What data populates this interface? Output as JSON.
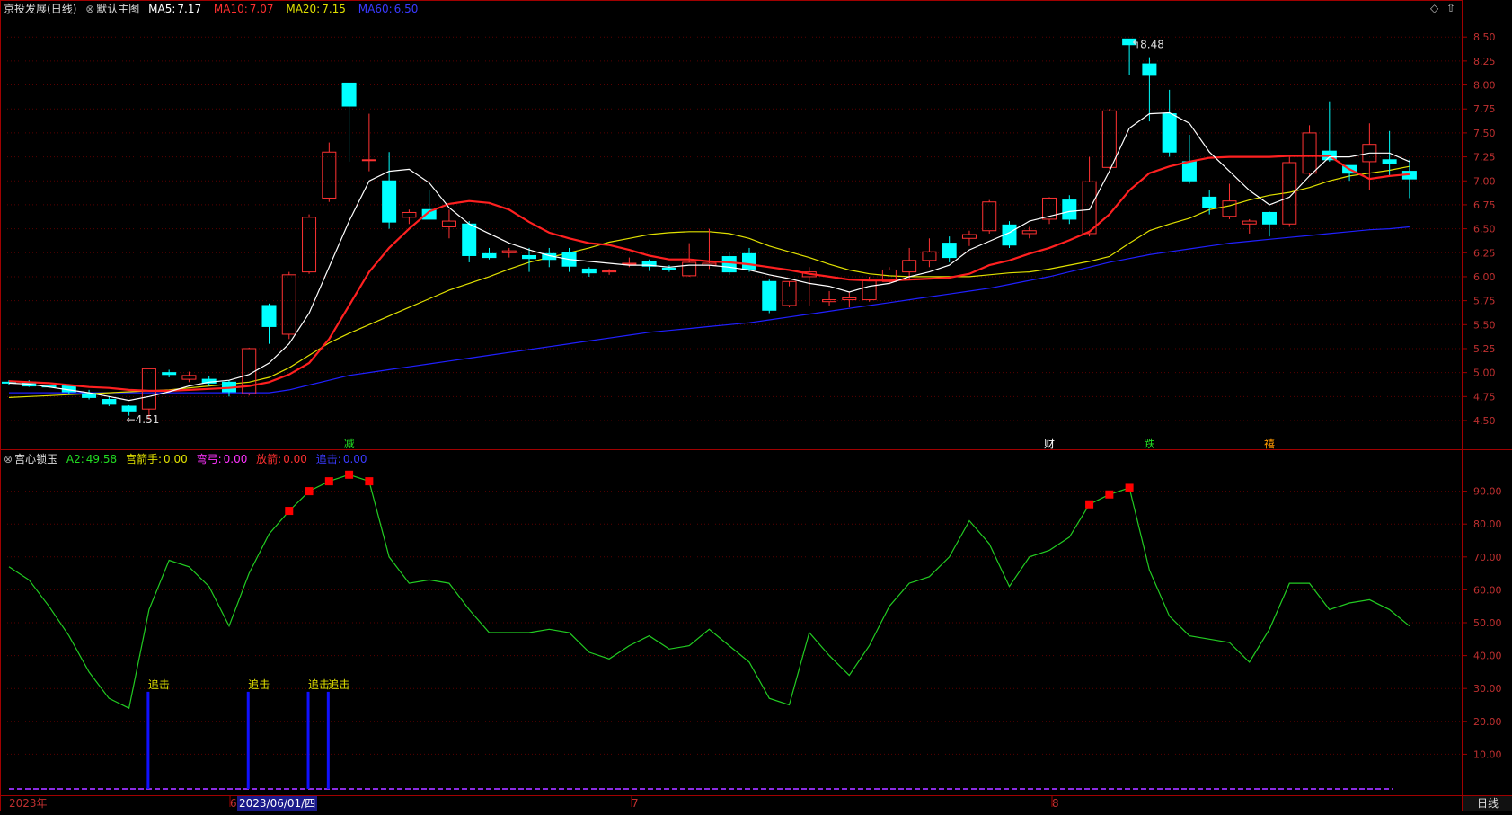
{
  "colors": {
    "bg": "#000000",
    "grid": "#5a0000",
    "axis": "#a00000",
    "up": "#ff3232",
    "down": "#00ffff",
    "ma5": "#ffffff",
    "ma10": "#ff2020",
    "ma20": "#e0e000",
    "ma60": "#2020ff",
    "osc": "#22cc22",
    "marker": "#ff0000",
    "pursuit": "#1010ff",
    "pursuit_label": "#e0e000"
  },
  "header": {
    "stock_name": "京投发展",
    "period_tag": "(日线)",
    "template_name": "默认主图",
    "ma5_label": "MA5:",
    "ma5_value": "7.17",
    "ma10_label": "MA10:",
    "ma10_value": "7.07",
    "ma20_label": "MA20:",
    "ma20_value": "7.15",
    "ma60_label": "MA60:",
    "ma60_value": "6.50",
    "diamond_icon": "◇",
    "up_arrow_icon": "⇧"
  },
  "indicator_header": {
    "name": "宫心锁玉",
    "a2_label": "A2:",
    "a2_value": "49.58",
    "gongjian_label": "宫箭手:",
    "gongjian_value": "0.00",
    "wangong_label": "弯弓:",
    "wangong_value": "0.00",
    "fangjian_label": "放箭:",
    "fangjian_value": "0.00",
    "zhuiji_label": "追击:",
    "zhuiji_value": "0.00"
  },
  "price_axis": [
    "8.50",
    "8.25",
    "8.00",
    "7.75",
    "7.50",
    "7.25",
    "7.00",
    "6.75",
    "6.50",
    "6.25",
    "6.00",
    "5.75",
    "5.50",
    "5.25",
    "5.00",
    "4.75",
    "4.50"
  ],
  "osc_axis": [
    "90.00",
    "80.00",
    "70.00",
    "60.00",
    "50.00",
    "40.00",
    "30.00",
    "20.00",
    "10.00"
  ],
  "annotations": {
    "high": "8.48",
    "low": "4.51"
  },
  "event_labels": [
    {
      "text": "减",
      "index": 17,
      "color": "#22dd22"
    },
    {
      "text": "财",
      "index": 52,
      "color": "#ffffff"
    },
    {
      "text": "跌",
      "index": 57,
      "color": "#22dd22"
    },
    {
      "text": "禧",
      "index": 63,
      "color": "#ff9900"
    }
  ],
  "pursuit_label": "追击",
  "time_axis": {
    "year": "2023年",
    "m6": "6",
    "cursor_date": "2023/06/01/四",
    "m7": "7",
    "m8": "8"
  },
  "period_button": "日线",
  "chart_data": {
    "type": "candlestick",
    "ylim": [
      4.35,
      8.68
    ],
    "osc_ylim": [
      0,
      100
    ],
    "candles": [
      [
        4.9,
        4.92,
        4.87,
        4.89
      ],
      [
        4.9,
        4.92,
        4.85,
        4.86
      ],
      [
        4.86,
        4.9,
        4.83,
        4.85
      ],
      [
        4.86,
        4.88,
        4.77,
        4.8
      ],
      [
        4.78,
        4.82,
        4.72,
        4.74
      ],
      [
        4.72,
        4.75,
        4.65,
        4.67
      ],
      [
        4.65,
        4.66,
        4.55,
        4.6
      ],
      [
        4.62,
        5.05,
        4.51,
        5.04
      ],
      [
        5.0,
        5.03,
        4.95,
        4.98
      ],
      [
        4.93,
        5.01,
        4.9,
        4.97
      ],
      [
        4.93,
        4.96,
        4.86,
        4.89
      ],
      [
        4.9,
        4.92,
        4.75,
        4.8
      ],
      [
        4.78,
        5.26,
        4.76,
        5.25
      ],
      [
        5.7,
        5.72,
        5.3,
        5.48
      ],
      [
        5.4,
        6.05,
        5.35,
        6.02
      ],
      [
        6.05,
        6.65,
        6.03,
        6.62
      ],
      [
        6.82,
        7.4,
        6.78,
        7.3
      ],
      [
        8.02,
        8.02,
        7.2,
        7.78
      ],
      [
        7.22,
        7.7,
        7.1,
        7.22
      ],
      [
        7.0,
        7.3,
        6.5,
        6.57
      ],
      [
        6.62,
        6.7,
        6.55,
        6.67
      ],
      [
        6.7,
        6.9,
        6.6,
        6.6
      ],
      [
        6.52,
        6.7,
        6.4,
        6.58
      ],
      [
        6.55,
        6.58,
        6.15,
        6.22
      ],
      [
        6.24,
        6.3,
        6.18,
        6.2
      ],
      [
        6.25,
        6.3,
        6.2,
        6.27
      ],
      [
        6.22,
        6.3,
        6.05,
        6.19
      ],
      [
        6.24,
        6.3,
        6.1,
        6.18
      ],
      [
        6.25,
        6.3,
        6.05,
        6.11
      ],
      [
        6.08,
        6.1,
        6.0,
        6.04
      ],
      [
        6.05,
        6.08,
        6.02,
        6.06
      ],
      [
        6.13,
        6.2,
        6.1,
        6.14
      ],
      [
        6.16,
        6.18,
        6.06,
        6.11
      ],
      [
        6.09,
        6.12,
        6.05,
        6.07
      ],
      [
        6.01,
        6.35,
        6.0,
        6.15
      ],
      [
        6.12,
        6.5,
        6.08,
        6.14
      ],
      [
        6.21,
        6.25,
        6.02,
        6.05
      ],
      [
        6.24,
        6.3,
        6.05,
        6.08
      ],
      [
        5.95,
        5.97,
        5.62,
        5.65
      ],
      [
        5.7,
        5.9,
        5.68,
        5.95
      ],
      [
        6.0,
        6.1,
        5.7,
        6.05
      ],
      [
        5.74,
        5.85,
        5.7,
        5.76
      ],
      [
        5.76,
        5.84,
        5.68,
        5.78
      ],
      [
        5.76,
        6.0,
        5.74,
        5.96
      ],
      [
        5.95,
        6.1,
        5.92,
        6.07
      ],
      [
        6.05,
        6.3,
        5.98,
        6.17
      ],
      [
        6.17,
        6.4,
        6.1,
        6.26
      ],
      [
        6.35,
        6.42,
        6.15,
        6.2
      ],
      [
        6.4,
        6.48,
        6.32,
        6.44
      ],
      [
        6.48,
        6.8,
        6.45,
        6.78
      ],
      [
        6.54,
        6.58,
        6.3,
        6.33
      ],
      [
        6.45,
        6.52,
        6.4,
        6.48
      ],
      [
        6.6,
        6.83,
        6.55,
        6.82
      ],
      [
        6.8,
        6.85,
        6.55,
        6.6
      ],
      [
        6.45,
        7.25,
        6.42,
        6.99
      ],
      [
        7.14,
        7.75,
        7.12,
        7.73
      ],
      [
        8.48,
        8.48,
        8.1,
        8.42
      ],
      [
        8.22,
        8.29,
        7.62,
        8.1
      ],
      [
        7.7,
        7.95,
        7.25,
        7.3
      ],
      [
        7.2,
        7.48,
        6.97,
        7.0
      ],
      [
        6.83,
        6.9,
        6.65,
        6.72
      ],
      [
        6.63,
        6.97,
        6.6,
        6.79
      ],
      [
        6.55,
        6.6,
        6.45,
        6.58
      ],
      [
        6.67,
        6.68,
        6.42,
        6.55
      ],
      [
        6.55,
        7.25,
        6.52,
        7.19
      ],
      [
        7.08,
        7.58,
        7.05,
        7.5
      ],
      [
        7.31,
        7.83,
        7.2,
        7.22
      ],
      [
        7.16,
        7.16,
        7.0,
        7.08
      ],
      [
        7.2,
        7.6,
        6.9,
        7.38
      ],
      [
        7.22,
        7.52,
        7.05,
        7.18
      ],
      [
        7.1,
        7.22,
        6.82,
        7.02
      ]
    ],
    "ma5": [
      4.89,
      4.88,
      4.85,
      4.82,
      4.79,
      4.75,
      4.71,
      4.75,
      4.8,
      4.86,
      4.9,
      4.92,
      4.98,
      5.1,
      5.3,
      5.62,
      6.1,
      6.58,
      7.0,
      7.1,
      7.12,
      6.98,
      6.72,
      6.55,
      6.45,
      6.35,
      6.28,
      6.22,
      6.18,
      6.16,
      6.14,
      6.12,
      6.12,
      6.1,
      6.12,
      6.12,
      6.1,
      6.07,
      6.02,
      5.98,
      5.93,
      5.9,
      5.84,
      5.9,
      5.93,
      6.0,
      6.05,
      6.12,
      6.28,
      6.37,
      6.46,
      6.58,
      6.63,
      6.68,
      6.7,
      7.1,
      7.55,
      7.7,
      7.71,
      7.6,
      7.3,
      7.1,
      6.9,
      6.75,
      6.83,
      7.05,
      7.25,
      7.25,
      7.29,
      7.29,
      7.2
    ],
    "ma10": [
      4.91,
      4.9,
      4.89,
      4.87,
      4.85,
      4.84,
      4.82,
      4.81,
      4.81,
      4.82,
      4.83,
      4.84,
      4.86,
      4.9,
      4.98,
      5.1,
      5.35,
      5.7,
      6.05,
      6.3,
      6.5,
      6.68,
      6.76,
      6.79,
      6.77,
      6.7,
      6.57,
      6.46,
      6.4,
      6.35,
      6.33,
      6.28,
      6.22,
      6.18,
      6.18,
      6.16,
      6.15,
      6.13,
      6.1,
      6.07,
      6.03,
      6.0,
      5.97,
      5.96,
      5.96,
      5.97,
      5.98,
      5.99,
      6.03,
      6.12,
      6.17,
      6.24,
      6.3,
      6.38,
      6.47,
      6.65,
      6.9,
      7.08,
      7.15,
      7.2,
      7.24,
      7.25,
      7.25,
      7.25,
      7.26,
      7.26,
      7.26,
      7.12,
      7.02,
      7.05,
      7.07
    ],
    "ma20": [
      4.74,
      4.75,
      4.76,
      4.77,
      4.78,
      4.79,
      4.8,
      4.81,
      4.82,
      4.84,
      4.86,
      4.88,
      4.9,
      4.95,
      5.05,
      5.18,
      5.31,
      5.41,
      5.5,
      5.59,
      5.68,
      5.77,
      5.86,
      5.93,
      6.0,
      6.08,
      6.15,
      6.2,
      6.25,
      6.3,
      6.36,
      6.4,
      6.44,
      6.46,
      6.47,
      6.47,
      6.45,
      6.4,
      6.32,
      6.26,
      6.2,
      6.13,
      6.07,
      6.03,
      6.01,
      6.0,
      6.0,
      6.0,
      6.0,
      6.02,
      6.04,
      6.05,
      6.08,
      6.12,
      6.16,
      6.21,
      6.35,
      6.48,
      6.55,
      6.61,
      6.7,
      6.74,
      6.8,
      6.85,
      6.88,
      6.93,
      7.0,
      7.05,
      7.08,
      7.11,
      7.15
    ],
    "ma60": [
      4.79,
      4.79,
      4.79,
      4.79,
      4.79,
      4.79,
      4.79,
      4.79,
      4.79,
      4.79,
      4.79,
      4.79,
      4.79,
      4.79,
      4.82,
      4.87,
      4.92,
      4.97,
      5.0,
      5.03,
      5.06,
      5.09,
      5.12,
      5.15,
      5.18,
      5.21,
      5.24,
      5.27,
      5.3,
      5.33,
      5.36,
      5.39,
      5.42,
      5.44,
      5.46,
      5.48,
      5.5,
      5.52,
      5.55,
      5.58,
      5.61,
      5.64,
      5.67,
      5.7,
      5.73,
      5.76,
      5.79,
      5.82,
      5.85,
      5.88,
      5.92,
      5.96,
      6.0,
      6.05,
      6.1,
      6.15,
      6.19,
      6.23,
      6.26,
      6.29,
      6.32,
      6.35,
      6.37,
      6.39,
      6.41,
      6.43,
      6.45,
      6.47,
      6.49,
      6.5,
      6.52
    ],
    "osc": [
      67,
      63,
      55,
      46,
      35,
      27,
      24,
      54,
      69,
      67,
      61,
      49,
      65,
      77,
      84,
      90,
      93,
      95,
      93,
      70,
      62,
      63,
      62,
      54,
      47,
      47,
      47,
      48,
      47,
      41,
      39,
      43,
      46,
      42,
      43,
      48,
      43,
      38,
      27,
      25,
      47,
      40,
      34,
      43,
      55,
      62,
      64,
      70,
      81,
      74,
      61,
      70,
      72,
      76,
      86,
      89,
      91,
      66,
      52,
      46,
      45,
      44,
      38,
      48,
      62,
      62,
      54,
      56,
      57,
      54,
      49
    ],
    "osc_markers": [
      14,
      15,
      16,
      17,
      18,
      54,
      55,
      56
    ],
    "pursuit": [
      7,
      12,
      15,
      16
    ]
  }
}
